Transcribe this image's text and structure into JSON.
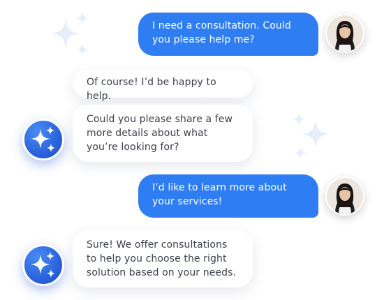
{
  "conversation": {
    "messages": [
      {
        "sender": "user",
        "text": "I need a consultation. Could you please help me?"
      },
      {
        "sender": "bot",
        "text": "Of course! I’d be happy to help."
      },
      {
        "sender": "bot",
        "text": "Could you please share a few more details about what you’re looking for?"
      },
      {
        "sender": "user",
        "text": "I’d like to learn more about your services!"
      },
      {
        "sender": "bot",
        "text": "Sure! We offer consultations to help you choose the right solution based on your needs."
      }
    ]
  },
  "icons": {
    "user_avatar": "user-avatar-photo",
    "bot_avatar": "sparkles-icon",
    "decoration": "sparkles-icon"
  },
  "colors": {
    "user_bubble": "#2f7df2",
    "bot_avatar": "#2a63dc",
    "bot_text": "#3b3f48",
    "decoration": "#e6eefc"
  }
}
